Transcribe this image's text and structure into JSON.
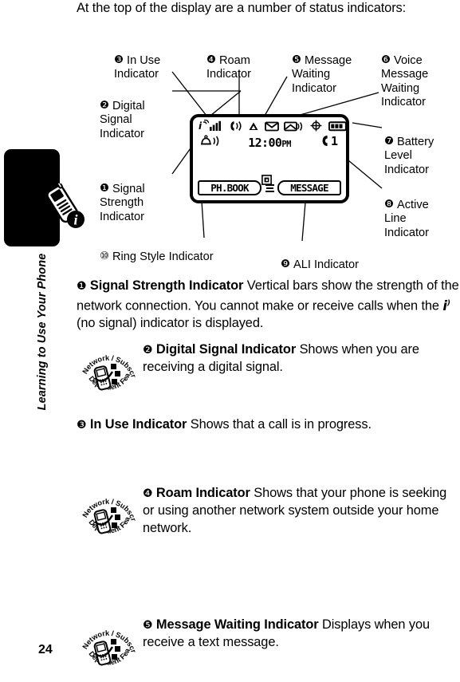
{
  "page": {
    "number": "24",
    "chapter_label": "Learning to Use Your Phone",
    "intro": "At the top of the display are a number of status indicators:"
  },
  "sidebar": {
    "tab_icon": "phone-info-icon"
  },
  "figure": {
    "callouts": [
      {
        "id": "c1",
        "num": "❶",
        "label": "Signal\nStrength\nIndicator"
      },
      {
        "id": "c2",
        "num": "❷",
        "label": "Digital\nSignal\nIndicator"
      },
      {
        "id": "c3",
        "num": "❸",
        "label": "In Use\nIndicator"
      },
      {
        "id": "c4",
        "num": "❹",
        "label": "Roam\nIndicator"
      },
      {
        "id": "c5",
        "num": "❺",
        "label": "Message\nWaiting\nIndicator"
      },
      {
        "id": "c6",
        "num": "❻",
        "label": "Voice\nMessage\nWaiting\nIndicator"
      },
      {
        "id": "c7",
        "num": "❼",
        "label": "Battery\nLevel\nIndicator"
      },
      {
        "id": "c8",
        "num": "❽",
        "label": "Active\nLine\nIndicator"
      },
      {
        "id": "c9",
        "num": "❾",
        "label": "ALI Indicator"
      },
      {
        "id": "c10",
        "num": "⑩",
        "label": "Ring Style Indicator"
      }
    ],
    "lcd": {
      "clock_time": "12:00",
      "clock_ampm": "PM",
      "active_line": "1",
      "softkey_left": "PH.BOOK",
      "softkey_right": "MESSAGE",
      "menu_icon": "menu-lines-icon",
      "status_icons": [
        "digital-signal-icon",
        "signal-strength-bars-icon",
        "in-use-icon",
        "roam-triangle-icon",
        "message-waiting-envelope-icon",
        "voice-message-waiting-icon",
        "ali-crosshair-icon",
        "battery-level-icon"
      ],
      "second_row_icons": [
        "ring-style-bell-icon",
        "ali-small-icon",
        "active-line-handset-icon"
      ]
    }
  },
  "content": {
    "paragraphs": [
      {
        "num": "❶",
        "title": "Signal Strength Indicator",
        "text_before": "Vertical bars show the strength of the network connection. You cannot make or receive calls when the ",
        "inline_icon": "no-signal-icon",
        "text_after": " (no signal) indicator is displayed.",
        "badge": false
      },
      {
        "num": "❷",
        "title": "Digital Signal Indicator",
        "text": "Shows when you are receiving a digital signal.",
        "badge": true
      },
      {
        "num": "❸",
        "title": "In Use Indicator",
        "text": "Shows that a call is in progress.",
        "badge": false
      },
      {
        "num": "❹",
        "title": "Roam Indicator",
        "text": "Shows that your phone is seeking or using another network system outside your home network.",
        "badge": true
      },
      {
        "num": "❺",
        "title": "Message Waiting Indicator",
        "text": "Displays when you receive a text message.",
        "badge": true
      }
    ],
    "badge_text": {
      "top": "Network / Subscription",
      "bottom": "Dependent Feature"
    }
  },
  "colors": {
    "ink": "#000000",
    "paper": "#ffffff"
  }
}
